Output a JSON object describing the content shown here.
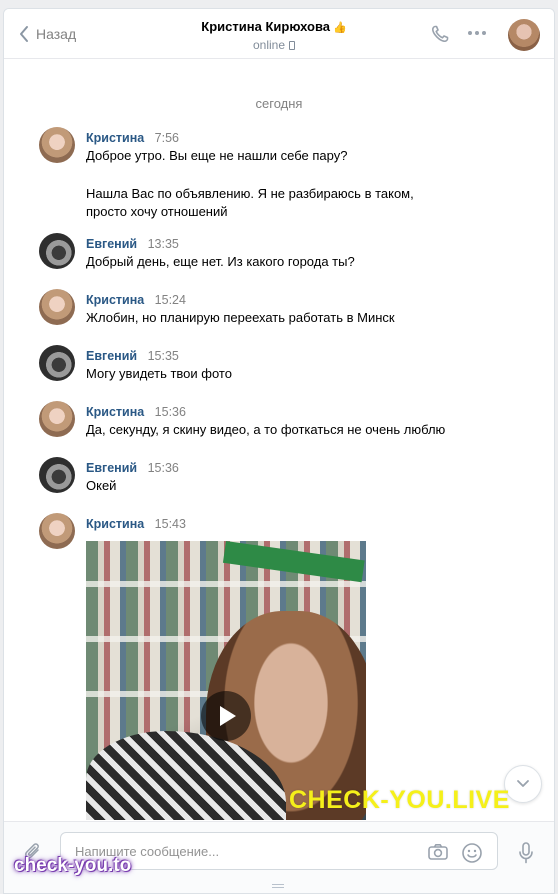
{
  "header": {
    "back_label": "Назад",
    "contact_name": "Кристина Кирюхова",
    "name_suffix_icon": "thumbs-up-emoji",
    "status": "online"
  },
  "chat": {
    "date_divider": "сегодня",
    "messages": [
      {
        "author": "Кристина",
        "time": "7:56",
        "lines": [
          "Доброе утро. Вы еще не нашли себе пару?"
        ]
      },
      {
        "author": "",
        "time": "",
        "lines": [
          "Нашла Вас по объявлению. Я не разбираюсь в таком,",
          "просто хочу отношений"
        ]
      },
      {
        "author": "Евгений",
        "time": "13:35",
        "lines": [
          "Добрый день, еще нет. Из какого города ты?"
        ]
      },
      {
        "author": "Кристина",
        "time": "15:24",
        "lines": [
          "Жлобин, но планирую переехать работать в Минск"
        ]
      },
      {
        "author": "Евгений",
        "time": "15:35",
        "lines": [
          "Могу увидеть твои фото"
        ]
      },
      {
        "author": "Кристина",
        "time": "15:36",
        "lines": [
          "Да, секунду, я скину видео, а то фоткаться не очень люблю"
        ]
      },
      {
        "author": "Евгений",
        "time": "15:36",
        "lines": [
          "Окей"
        ]
      },
      {
        "author": "Кристина",
        "time": "15:43",
        "lines": []
      }
    ]
  },
  "composer": {
    "placeholder": "Напишите сообщение..."
  },
  "watermarks": {
    "big": "CHECK-YOU.LIVE",
    "small": "check-you.to"
  },
  "colors": {
    "author": "#2a5885",
    "watermark_big": "#f5f01a",
    "watermark_small_glow": "#7a3fb0"
  }
}
